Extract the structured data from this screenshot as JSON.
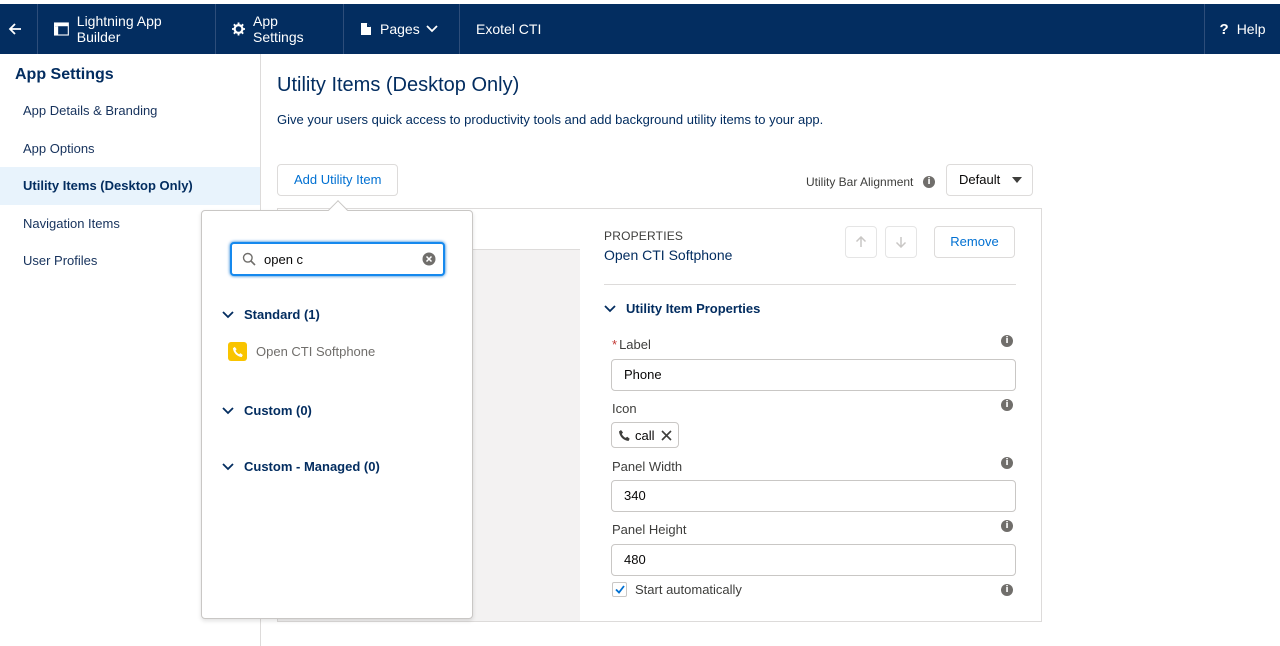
{
  "topbar": {
    "builder_label": "Lightning App Builder",
    "settings_label": "App Settings",
    "pages_label": "Pages",
    "app_name": "Exotel CTI",
    "help_label": "Help"
  },
  "sidebar": {
    "title": "App Settings",
    "items": [
      {
        "label": "App Details & Branding"
      },
      {
        "label": "App Options"
      },
      {
        "label": "Utility Items (Desktop Only)"
      },
      {
        "label": "Navigation Items"
      },
      {
        "label": "User Profiles"
      }
    ]
  },
  "main": {
    "title": "Utility Items (Desktop Only)",
    "subtitle": "Give your users quick access to productivity tools and add background utility items to your app.",
    "add_button": "Add Utility Item",
    "alignment_label": "Utility Bar Alignment",
    "alignment_value": "Default"
  },
  "properties": {
    "caption": "PROPERTIES",
    "item_name": "Open CTI Softphone",
    "remove_label": "Remove",
    "section_title": "Utility Item Properties",
    "label_field": {
      "label": "Label",
      "required_mark": "*",
      "value": "Phone"
    },
    "icon_field": {
      "label": "Icon",
      "value": "call"
    },
    "panel_width": {
      "label": "Panel Width",
      "value": "340"
    },
    "panel_height": {
      "label": "Panel Height",
      "value": "480"
    },
    "start_auto": {
      "label": "Start automatically",
      "checked": true
    }
  },
  "popover": {
    "search_value": "open c",
    "groups": [
      {
        "label": "Standard (1)"
      },
      {
        "label": "Custom (0)"
      },
      {
        "label": "Custom - Managed (0)"
      }
    ],
    "result_label": "Open CTI Softphone"
  },
  "colors": {
    "brand_navy": "#032d60",
    "link_blue": "#0070d2",
    "focus_blue": "#1589ee",
    "active_bg": "#e8f3fc",
    "phone_icon_bg": "#f9c400"
  }
}
